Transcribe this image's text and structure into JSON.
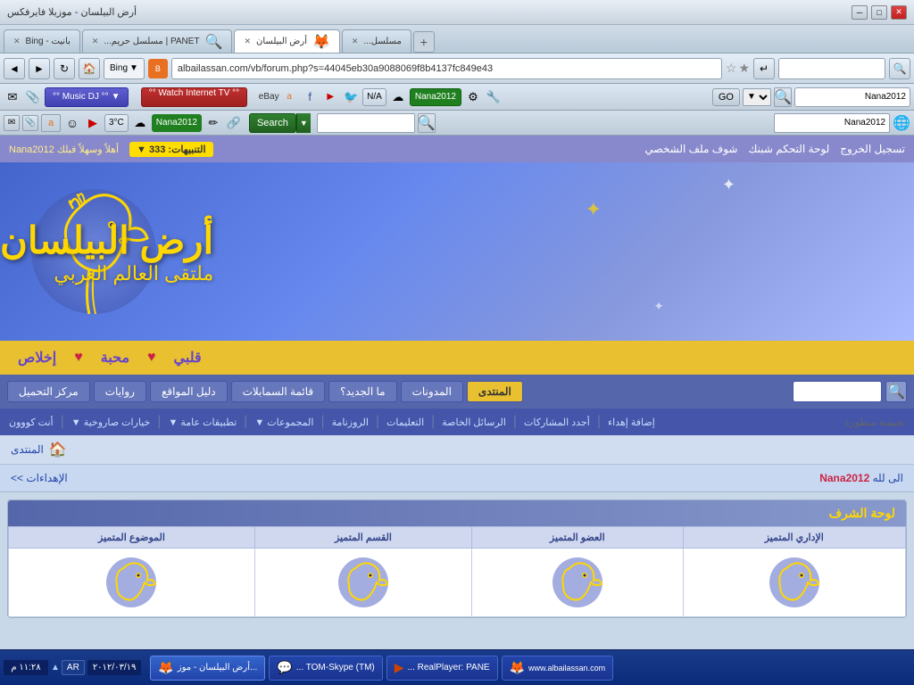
{
  "browser": {
    "title": "أرض البيلسان - موزيلا فايرفكس",
    "tabs": [
      {
        "label": "بانيت - Bing - ب...",
        "active": false,
        "id": "tab1"
      },
      {
        "label": "PANET | مسلسل حريم السلطان , مشاهد...",
        "active": false,
        "id": "tab2"
      },
      {
        "label": "أرض البيلسان",
        "active": true,
        "id": "tab3"
      },
      {
        "label": "مسلسل...",
        "active": false,
        "id": "tab4"
      }
    ],
    "address": "albailassan.com/vb/forum.php?s=44045eb30a9088069f8b4137fc849e43",
    "search_placeholder": "Bing",
    "new_tab": "+",
    "nav_back": "◄",
    "nav_forward": "►",
    "refresh": "↻",
    "home": "🏠",
    "bookmark": "☆"
  },
  "toolbar1": {
    "music_dj": "°° Music DJ °°",
    "watch_tv": "°° Watch Internet TV °°",
    "nana_label": "Nana2012",
    "go_label": "GO",
    "search_value": "Nana2012",
    "icons": [
      "✉",
      "📋",
      "☆",
      "A",
      "▶",
      "T",
      "f",
      "N/A",
      "☁"
    ],
    "orange": "B"
  },
  "toolbar2": {
    "search_label": "Search",
    "search_placeholder": "",
    "nana2012": "Nana2012",
    "search_right": "Nana2012",
    "icons": [
      "A",
      "☺",
      "▶",
      "3°C",
      "☁"
    ],
    "temp": "3°C"
  },
  "site": {
    "top_nav": {
      "logout": "تسجيل الخروج",
      "control_panel": "لوحة التحكم شبنك",
      "profile": "شوف ملف الشخصي",
      "notifications": "التنبيهات: 333 ▼",
      "welcome": "أهلاً وسهلاً قبلك Nana2012"
    },
    "header": {
      "title": "أرض البيلسان",
      "subtitle": "ملتقى العالم العربي"
    },
    "gold_nav": {
      "items": [
        "قلبي",
        "محبة",
        "إخلاص"
      ],
      "has_hearts": true
    },
    "blue_nav": {
      "items": [
        {
          "label": "المنتدى",
          "active": true
        },
        {
          "label": "المدونات",
          "active": false
        },
        {
          "label": "ما الجديد؟",
          "active": false
        },
        {
          "label": "قائمة السمابلات",
          "active": false
        },
        {
          "label": "دليل المواقع",
          "active": false
        },
        {
          "label": "روايات",
          "active": false
        },
        {
          "label": "مركز التحميل",
          "active": false
        }
      ],
      "search_placeholder": ""
    },
    "sub_nav": {
      "items": [
        "إضافة إهداء",
        "أجدد المشاركات",
        "الرسائل الخاصة",
        "التعليمات",
        "الروزنامة",
        "المجموعات ▼",
        "تطبيقات عامة ▼",
        "خيارات صاروخية ▼",
        "أنت كووون",
        "بحبشة منظورة"
      ]
    },
    "breadcrumb": {
      "home_icon": "🏠",
      "forum_link": "المنتدى"
    },
    "dedication": {
      "left_text": "الى لله",
      "user_link": "Nana2012",
      "right_text": "الإهداءات >>",
      "arrows": "<<"
    },
    "honor_board": {
      "title": "لوحة الشرف",
      "columns": [
        "الإداري المتميز",
        "العضو المتميز",
        "القسم المتميز",
        "الموضوع المتميز"
      ]
    }
  },
  "taskbar": {
    "time": "١١:٢٨ م",
    "date": "٢٠١٢/٠٣/١٩",
    "lang": "AR",
    "buttons": [
      {
        "label": "أرض البيلسان - موز...",
        "icon": "🦊",
        "active": true
      },
      {
        "label": "... TOM-Skype (TM)",
        "icon": "💬",
        "active": false
      },
      {
        "label": "... RealPlayer: PANE",
        "icon": "▶",
        "active": false
      },
      {
        "label": "... www.albailassan.com",
        "icon": "🦊",
        "active": false
      }
    ],
    "site_badge": "www.albailassan.com"
  }
}
